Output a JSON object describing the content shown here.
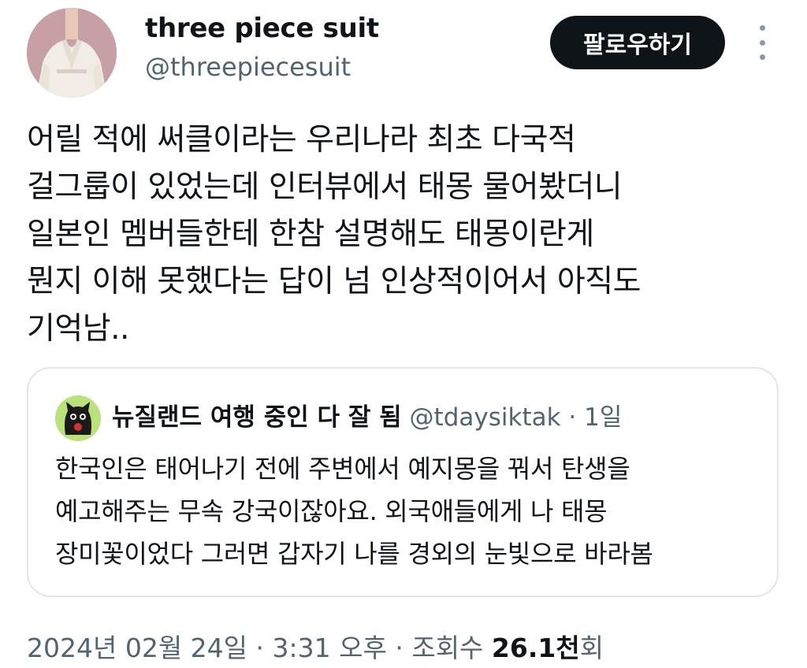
{
  "author": {
    "display_name": "three piece suit",
    "handle": "@threepiecesuit"
  },
  "follow_label": "팔로우하기",
  "more_icon": "more-vertical-icon",
  "tweet_text": "어릴 적에 써클이라는 우리나라 최초 다국적\n걸그룹이 있었는데 인터뷰에서 태몽 물어봤더니\n일본인 멤버들한테 한참 설명해도 태몽이란게\n뭔지 이해 못했다는 답이 넘 인상적이어서 아직도\n기억남..",
  "quote": {
    "display_name": "뉴질랜드 여행 중인 다 잘 됨",
    "handle": "@tdaysiktak",
    "time": "· 1일",
    "text": "한국인은 태어나기 전에 주변에서 예지몽을 꿔서 탄생을\n예고해주는 무속 강국이잖아요. 외국애들에게 나 태몽\n장미꽃이었다 그러면 갑자기 나를 경외의 눈빛으로 바라봄",
    "avatar_color": "#b9e27b"
  },
  "meta": {
    "date": "2024년 02월 24일",
    "time": "3:31 오후",
    "views_label": "조회수",
    "views_count": "26.1천",
    "views_unit": "회"
  },
  "colors": {
    "text": "#0f1419",
    "secondary": "#536471",
    "follow_bg": "#0f1419",
    "border": "#e1e6ea"
  }
}
